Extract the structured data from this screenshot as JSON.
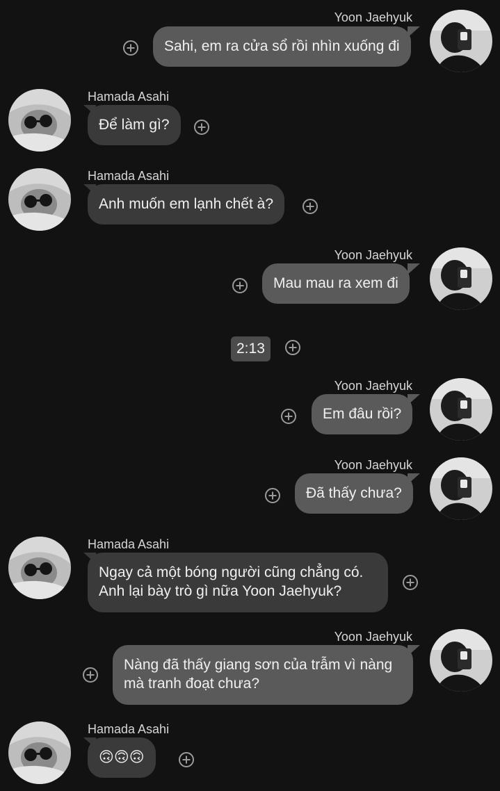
{
  "participants": {
    "me": "Yoon Jaehyuk",
    "other": "Hamada Asahi"
  },
  "messages": [
    {
      "sender": "Yoon Jaehyuk",
      "text": "Sahi, em ra cửa sổ rồi nhìn xuống đi"
    },
    {
      "sender": "Hamada Asahi",
      "text": "Để làm gì?"
    },
    {
      "sender": "Hamada Asahi",
      "text": "Anh muốn em lạnh chết à?"
    },
    {
      "sender": "Yoon Jaehyuk",
      "text": "Mau mau ra xem đi"
    },
    {
      "sender": "Yoon Jaehyuk",
      "text": "Em đâu rồi?"
    },
    {
      "sender": "Yoon Jaehyuk",
      "text": "Đã thấy chưa?"
    },
    {
      "sender": "Hamada Asahi",
      "text": "Ngay cả một bóng người cũng chẳng có.\nAnh lại bày trò gì nữa Yoon Jaehyuk?"
    },
    {
      "sender": "Yoon Jaehyuk",
      "text": "Nàng đã thấy giang sơn của trẫm vì nàng\nmà tranh đoạt chưa?"
    },
    {
      "sender": "Hamada Asahi",
      "text": "🙃🙃🙃"
    }
  ],
  "timestamp": "2:13",
  "icons": {
    "add_reaction": "plus-circle-icon"
  },
  "colors": {
    "background": "#121212",
    "bubble_left": "#3a3a3a",
    "bubble_right": "#5a5a5a",
    "time_chip": "#4c4c4c"
  }
}
